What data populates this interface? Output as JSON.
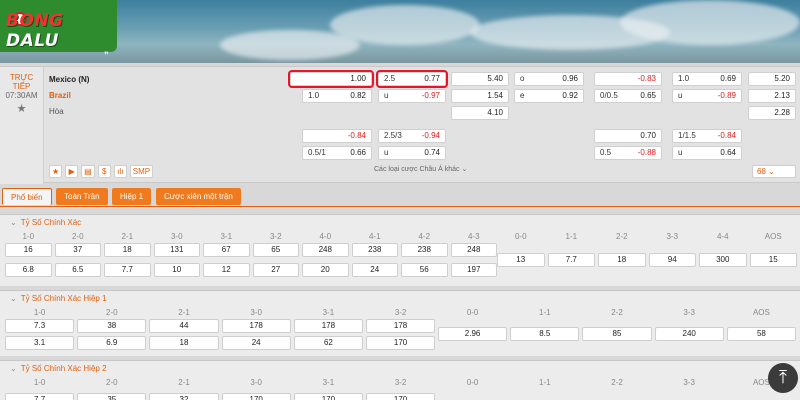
{
  "brand": {
    "logo_bong": "BONG",
    "logo_dalu": "DALU",
    "quote_mark": "”"
  },
  "match": {
    "status": "TRỰC TIẾP",
    "time": "07:30AM",
    "favorite_icon": "star-icon",
    "home": "Mexico (N)",
    "away": "Brazil",
    "draw": "Hòa",
    "ft": {
      "ah_main": {
        "home_val": "1.00",
        "away_line": "1.0",
        "away_val": "0.82"
      },
      "ou_main": {
        "line": "2.5",
        "over": "0.77",
        "u_label": "u",
        "under": "-0.97"
      },
      "x12": {
        "home": "5.40",
        "away": "1.54",
        "draw": "4.10"
      },
      "oe": {
        "o_label": "o",
        "o_val": "0.96",
        "e_label": "e",
        "e_val": "0.92"
      },
      "ah_alt": {
        "home_val": "-0.84",
        "away_line": "0.5/1",
        "away_val": "0.66"
      },
      "ou_alt": {
        "line": "2.5/3",
        "over": "-0.94",
        "u_label": "u",
        "under": "0.74"
      }
    },
    "h1": {
      "ah_main": {
        "home_val": "-0.83",
        "away_line": "0/0.5",
        "away_val": "0.65"
      },
      "ou_main": {
        "line": "1.0",
        "over": "0.69",
        "u_label": "u",
        "under": "-0.89"
      },
      "x12": {
        "home": "5.20",
        "away": "2.13",
        "draw": "2.28"
      },
      "ah_alt": {
        "home_val": "0.70",
        "away_line": "0.5",
        "away_val": "-0.88"
      },
      "ou_alt": {
        "line": "1/1.5",
        "over": "-0.84",
        "u_label": "u",
        "under": "0.64"
      }
    },
    "tools": [
      "★",
      "▶",
      "▤",
      "$",
      "ılı",
      "SMP"
    ],
    "more_bets": "Các loại cược Châu Á khác ⌄",
    "count": "68 ⌄"
  },
  "tabs": [
    "Phổ biến",
    "Toàn Trận",
    "Hiệp 1",
    "Cược xiên một trận"
  ],
  "sections": {
    "s1": {
      "title": "Tỷ Số Chính Xác",
      "headers": [
        "1-0",
        "2-0",
        "2-1",
        "3-0",
        "3-1",
        "3-2",
        "4-0",
        "4-1",
        "4-2",
        "4-3",
        "0-0",
        "1-1",
        "2-2",
        "3-3",
        "4-4",
        "AOS"
      ],
      "row1": [
        "16",
        "37",
        "18",
        "131",
        "67",
        "65",
        "248",
        "238",
        "238",
        "248"
      ],
      "row2": [
        "6.8",
        "6.5",
        "7.7",
        "10",
        "12",
        "27",
        "20",
        "24",
        "56",
        "197"
      ],
      "draws": [
        "13",
        "7.7",
        "18",
        "94",
        "300",
        "15"
      ]
    },
    "s2": {
      "title": "Tỷ Số Chính Xác Hiệp 1",
      "headers": [
        "1-0",
        "2-0",
        "2-1",
        "3-0",
        "3-1",
        "3-2",
        "0-0",
        "1-1",
        "2-2",
        "3-3",
        "AOS"
      ],
      "row1": [
        "7.3",
        "38",
        "44",
        "178",
        "178",
        "178"
      ],
      "row2": [
        "3.1",
        "6.9",
        "18",
        "24",
        "62",
        "170"
      ],
      "draws": [
        "2.96",
        "8.5",
        "85",
        "240",
        "58"
      ]
    },
    "s3": {
      "title": "Tỷ Số Chính Xác Hiệp 2",
      "headers": [
        "1-0",
        "2-0",
        "2-1",
        "3-0",
        "3-1",
        "3-2",
        "0-0",
        "1-1",
        "2-2",
        "3-3",
        "AOS"
      ],
      "row1": [
        "7.7",
        "35",
        "32",
        "170",
        "170",
        "170"
      ]
    }
  },
  "scroll_top_icon": "arrow-up-to-top-icon"
}
